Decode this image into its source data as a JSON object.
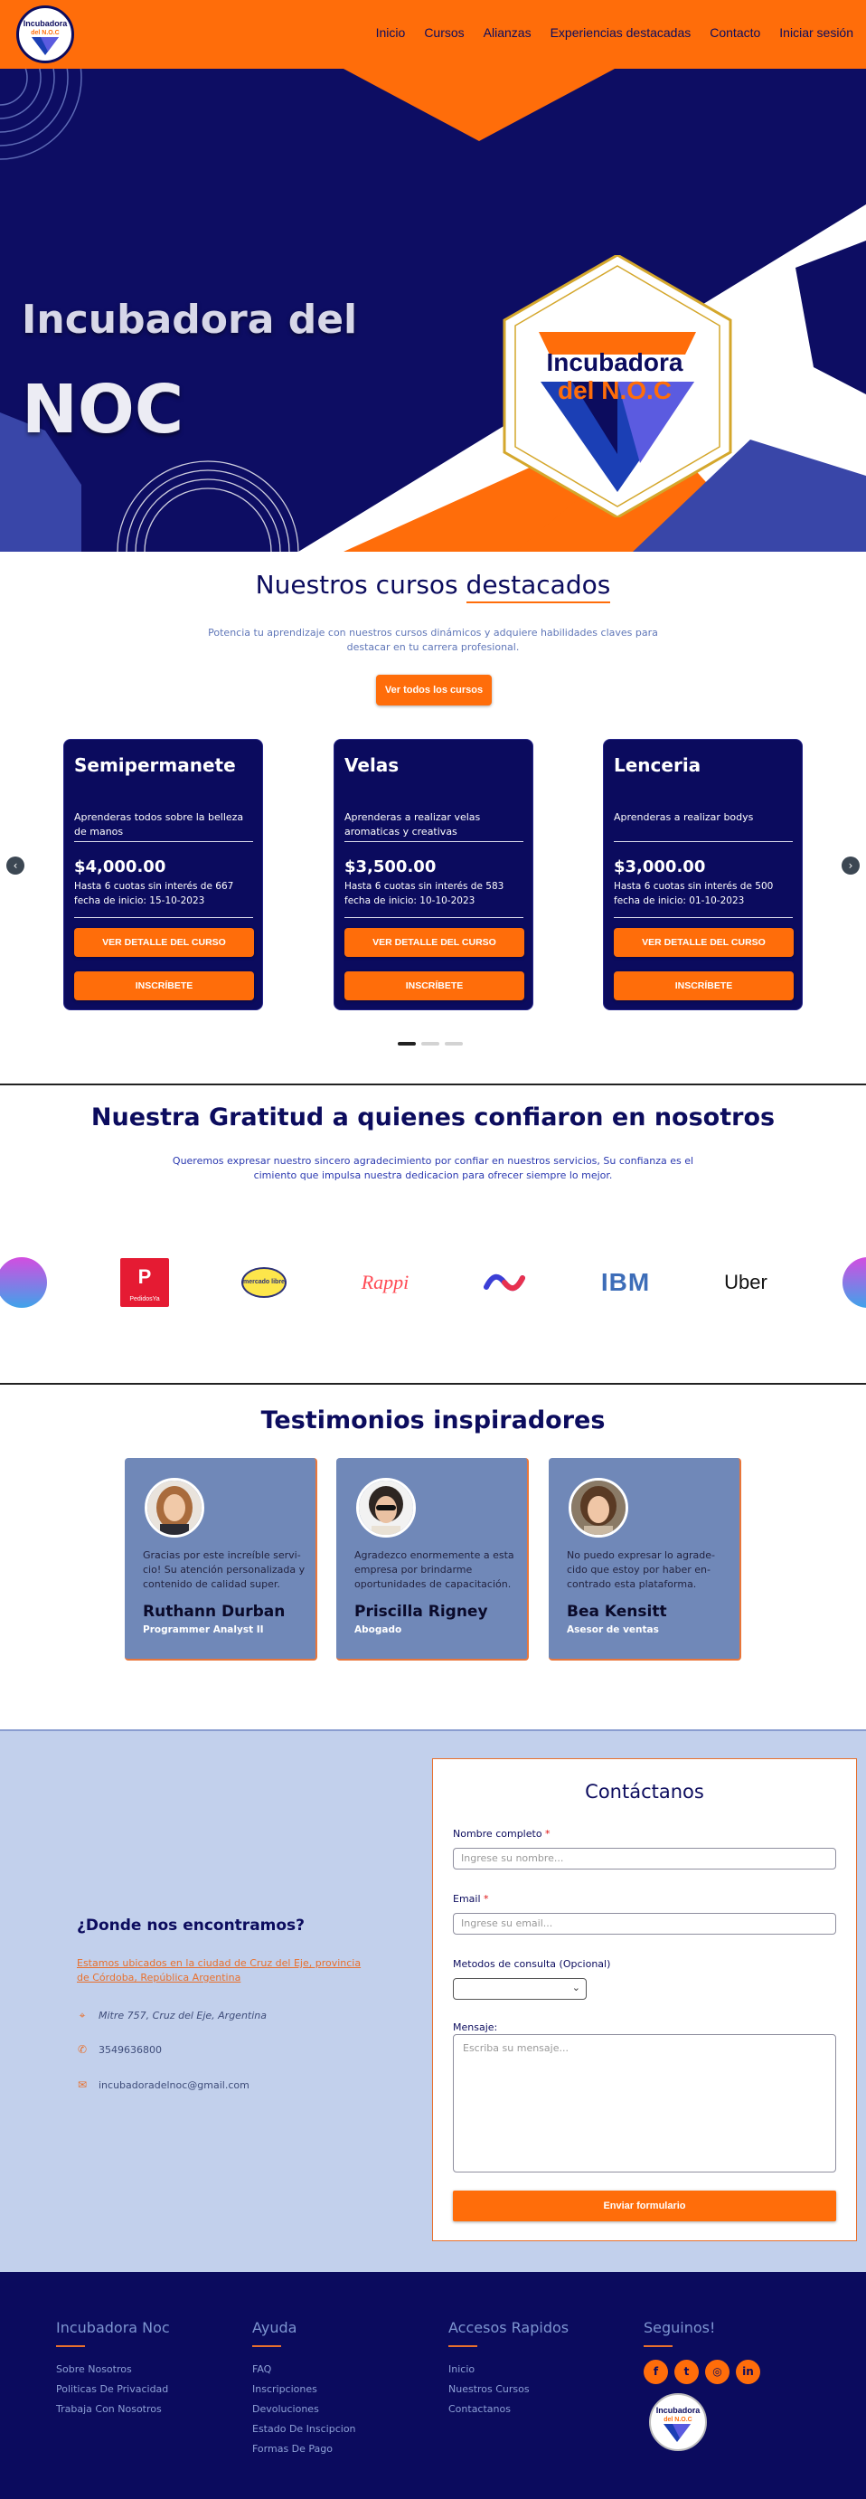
{
  "brand": {
    "logo_line1": "Incubadora",
    "logo_line2": "del N.O.C"
  },
  "nav": {
    "items": [
      "Inicio",
      "Cursos",
      "Alianzas",
      "Experiencias destacadas",
      "Contacto",
      "Iniciar sesión"
    ]
  },
  "hero": {
    "title_line1": "Incubadora del",
    "title_line2": "NOC",
    "logo_line1": "Incubadora",
    "logo_line2": "del N.O.C"
  },
  "courses": {
    "title_part1": "Nuestros cursos",
    "title_part2": "destacados",
    "subtitle": "Potencia tu aprendizaje con nuestros cursos dinámicos y adquiere habilidades claves para destacar en tu carrera profesional.",
    "see_all_label": "Ver todos los cursos",
    "detail_label": "VER DETALLE DEL CURSO",
    "enroll_label": "INSCRÍBETE",
    "items": [
      {
        "title": "Semipermanete",
        "description": "Aprenderas todos sobre la belleza de manos",
        "price": "$4,000.00",
        "installments": "Hasta 6 cuotas sin interés de 667",
        "start_date": "fecha de inicio: 15-10-2023"
      },
      {
        "title": "Velas",
        "description": "Aprenderas a realizar velas aromaticas y creativas",
        "price": "$3,500.00",
        "installments": "Hasta 6 cuotas sin interés de 583",
        "start_date": "fecha de inicio: 10-10-2023"
      },
      {
        "title": "Lenceria",
        "description": "Aprenderas a realizar bodys",
        "price": "$3,000.00",
        "installments": "Hasta 6 cuotas sin interés de 500",
        "start_date": "fecha de inicio: 01-10-2023"
      }
    ],
    "carousel_total": 3,
    "carousel_active": 1
  },
  "gratitude": {
    "title": "Nuestra Gratitud a quienes confiaron en nosotros",
    "subtitle": "Queremos expresar nuestro sincero agradecimiento por confiar en nuestros servicios, Su confianza es el cimiento que impulsa nuestra dedicacion para ofrecer siempre lo mejor.",
    "brands": [
      "PedidosYa",
      "mercado libre",
      "Rappi",
      "IBM",
      "Uber"
    ]
  },
  "testimonials": {
    "title": "Testimonios inspiradores",
    "items": [
      {
        "text": "Gracias por este increíble servi-cio! Su atención personalizada y contenido de calidad super.",
        "name": "Ruthann Durban",
        "role": "Programmer Analyst II"
      },
      {
        "text": "Agradezco enormemente a esta empresa por brindarme oportunidades de capacitación.",
        "name": "Priscilla Rigney",
        "role": "Abogado"
      },
      {
        "text": "No puedo expresar lo agrade-cido que estoy por haber en-contrado esta plataforma.",
        "name": "Bea Kensitt",
        "role": "Asesor de ventas"
      }
    ]
  },
  "contact": {
    "where_title": "¿Donde nos encontramos?",
    "address_link": "Estamos ubicados en la ciudad de Cruz del Eje, provincia de Córdoba, República Argentina",
    "street": "Mitre 757, Cruz del Eje, Argentina",
    "phone": "3549636800",
    "email": "incubadoradelnoc@gmail.com",
    "form": {
      "title": "Contáctanos",
      "name_label": "Nombre completo",
      "name_placeholder": "Ingrese su nombre...",
      "email_label": "Email",
      "email_placeholder": "Ingrese su email...",
      "method_label": "Metodos de consulta (Opcional)",
      "method_value": "",
      "message_label": "Mensaje:",
      "message_placeholder": "Escriba su mensaje...",
      "submit_label": "Enviar formulario",
      "required_mark": "*"
    }
  },
  "footer": {
    "col1": {
      "title": "Incubadora Noc",
      "links": [
        "Sobre Nosotros",
        "Politicas De Privacidad",
        "Trabaja Con Nosotros"
      ]
    },
    "col2": {
      "title": "Ayuda",
      "links": [
        "FAQ",
        "Inscripciones",
        "Devoluciones",
        "Estado De Inscipcion",
        "Formas De Pago"
      ]
    },
    "col3": {
      "title": "Accesos Rapidos",
      "links": [
        "Inicio",
        "Nuestros Cursos",
        "Contactanos"
      ]
    },
    "col4": {
      "title": "Seguinos!",
      "socials": [
        "facebook-icon",
        "twitter-icon",
        "instagram-icon",
        "linkedin-icon"
      ]
    }
  },
  "colors": {
    "primary": "#0c0c5e",
    "accent": "#ff6d0a",
    "contact_bg": "#c2d0ec",
    "testimonial_card": "#7088b8"
  }
}
